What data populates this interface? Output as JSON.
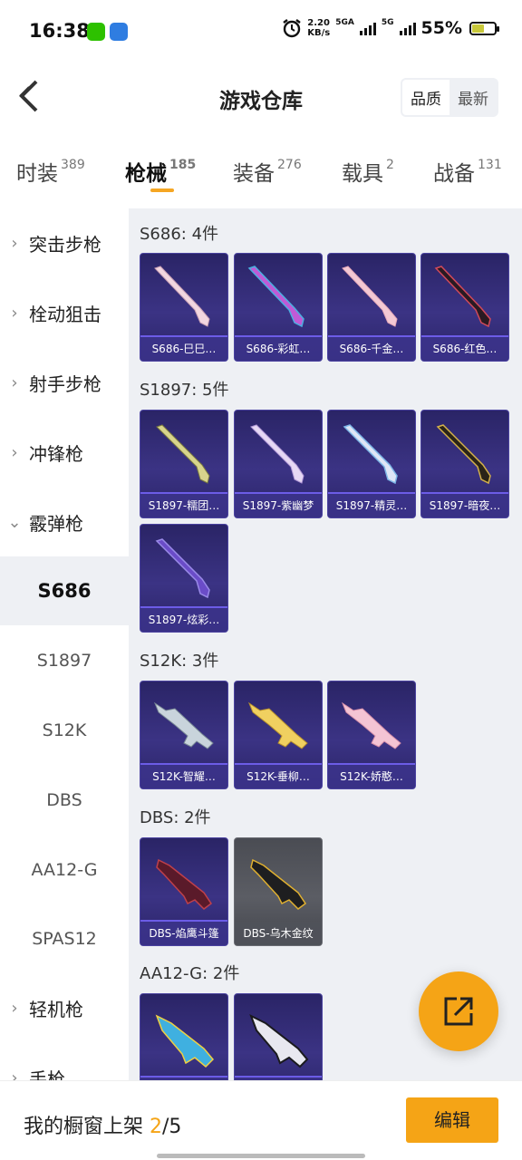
{
  "status_bar": {
    "time": "16:38",
    "speed_value": "2.20",
    "speed_unit": "KB/s",
    "net1": "5GA",
    "net2": "5G",
    "battery": "55%",
    "battery_level": 0.55
  },
  "header": {
    "title": "游戏仓库",
    "sort_options": [
      "品质",
      "最新"
    ],
    "sort_selected": "品质"
  },
  "tabs": [
    {
      "label": "时装",
      "count": "389"
    },
    {
      "label": "枪械",
      "count": "185"
    },
    {
      "label": "装备",
      "count": "276"
    },
    {
      "label": "载具",
      "count": "2"
    },
    {
      "label": "战备",
      "count": "131"
    }
  ],
  "active_tab": "枪械",
  "sidebar": {
    "items": [
      {
        "label": "突击步枪",
        "chevron": "›"
      },
      {
        "label": "栓动狙击",
        "chevron": "›"
      },
      {
        "label": "射手步枪",
        "chevron": "›"
      },
      {
        "label": "冲锋枪",
        "chevron": "›"
      },
      {
        "label": "霰弹枪",
        "chevron": "⌄"
      },
      {
        "label": "S686"
      },
      {
        "label": "S1897"
      },
      {
        "label": "S12K"
      },
      {
        "label": "DBS"
      },
      {
        "label": "AA12-G"
      },
      {
        "label": "SPAS12"
      },
      {
        "label": "轻机枪",
        "chevron": "›"
      },
      {
        "label": "手枪",
        "chevron": "›"
      }
    ],
    "selected": "S686"
  },
  "groups": [
    {
      "title": "S686: 4件",
      "items": [
        "S686-巳巳…",
        "S686-彩虹…",
        "S686-千金…",
        "S686-红色…"
      ]
    },
    {
      "title": "S1897: 5件",
      "items": [
        "S1897-糯团…",
        "S1897-紫幽梦",
        "S1897-精灵…",
        "S1897-暗夜…",
        "S1897-炫彩…"
      ]
    },
    {
      "title": "S12K: 3件",
      "items": [
        "S12K-智耀…",
        "S12K-垂柳…",
        "S12K-娇憨…"
      ]
    },
    {
      "title": "DBS: 2件",
      "items": [
        "DBS-焰鹰斗篷",
        "DBS-乌木金纹"
      ]
    },
    {
      "title": "AA12-G: 2件",
      "items": [
        "",
        ""
      ]
    }
  ],
  "bottom": {
    "label": "我的橱窗上架 ",
    "current": "2",
    "total": "/5",
    "edit_label": "编辑"
  },
  "colors": {
    "accent": "#f5a416",
    "card_purple": "#3b3384",
    "card_gray": "#5b5d64",
    "panel_bg": "#eef0f4"
  }
}
